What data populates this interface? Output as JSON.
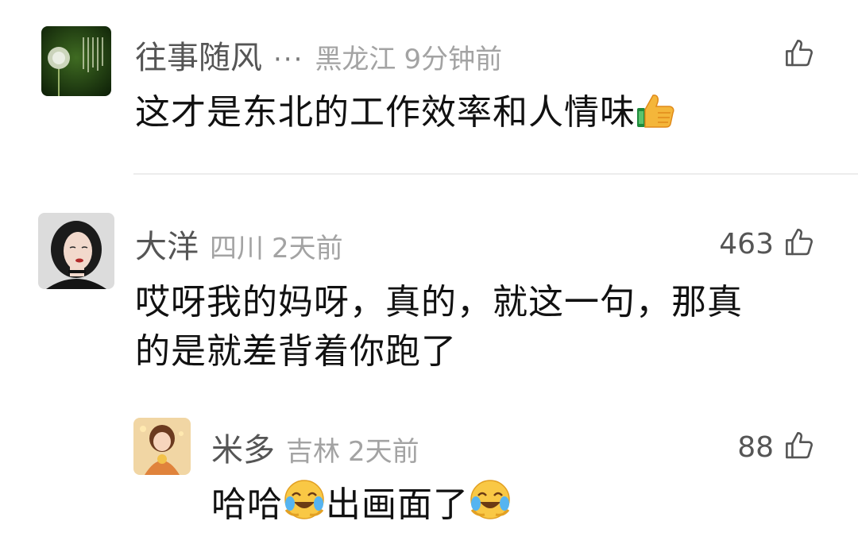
{
  "comments": [
    {
      "name": "往事随风",
      "more": "···",
      "region": "黑龙江",
      "time": "9分钟前",
      "likes": "",
      "text": "这才是东北的工作效率和人情味",
      "emoji": "thumbs-up-emoji"
    },
    {
      "name": "大洋",
      "region": "四川",
      "time": "2天前",
      "likes": "463",
      "text_line1": "哎呀我的妈呀，真的，就这一句，那真",
      "text_line2": "的是就差背着你跑了"
    },
    {
      "name": "米多",
      "region": "吉林",
      "time": "2天前",
      "likes": "88",
      "text_part1": "哈哈",
      "text_part2": "出画面了",
      "emoji": "laughing-crying-emoji"
    }
  ],
  "icons": {
    "like": "thumbs-up-outline-icon"
  },
  "colors": {
    "name": "#555555",
    "meta": "#a3a3a3",
    "body": "#111111",
    "divider": "#ececec"
  }
}
